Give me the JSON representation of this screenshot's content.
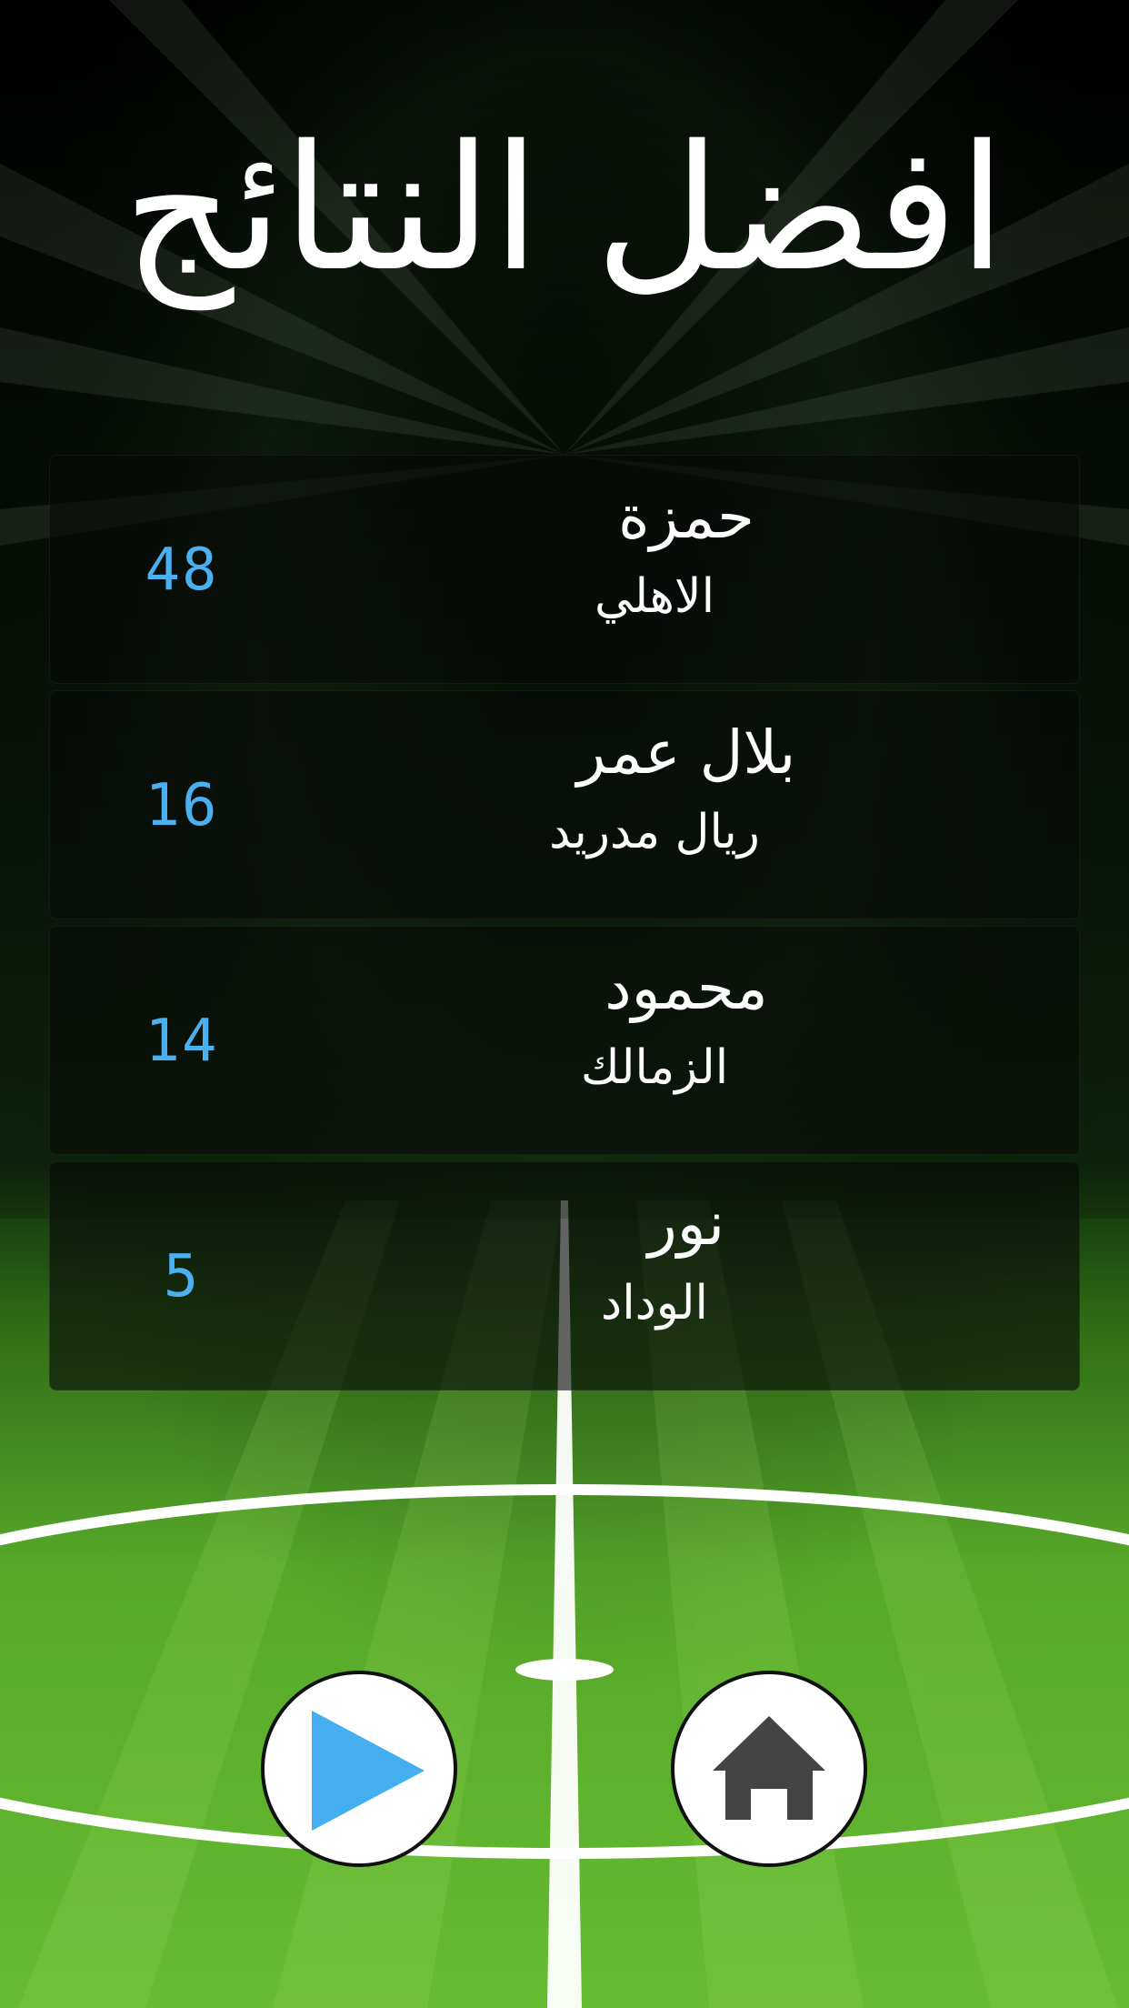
{
  "screen": {
    "title": "افضل النتائج"
  },
  "leaderboard": [
    {
      "name": "حمزة",
      "team": "الاهلي",
      "score": "48"
    },
    {
      "name": "بلال عمر",
      "team": "ريال مدريد",
      "score": "16"
    },
    {
      "name": "محمود",
      "team": "الزمالك",
      "score": "14"
    },
    {
      "name": "نور",
      "team": "الوداد",
      "score": "5"
    }
  ],
  "buttons": {
    "play": {
      "icon": "play-icon",
      "color": "#44aef0"
    },
    "home": {
      "icon": "home-icon",
      "color": "#444444"
    }
  },
  "colors": {
    "score": "#4ab0ef",
    "pitch": "#5fb52c",
    "background_top": "#000000"
  }
}
